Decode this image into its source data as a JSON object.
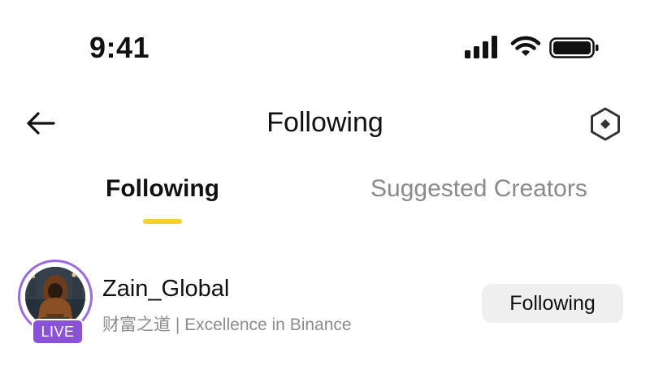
{
  "status_bar": {
    "time": "9:41",
    "icons": [
      "signal-icon",
      "wifi-icon",
      "battery-icon"
    ]
  },
  "header": {
    "title": "Following",
    "back_icon": "back-arrow-icon",
    "settings_icon": "hexagon-settings-icon"
  },
  "tabs": [
    {
      "label": "Following",
      "active": true
    },
    {
      "label": "Suggested Creators",
      "active": false
    }
  ],
  "accent_color": "#f5cf2c",
  "live_color": "#8a52d9",
  "following_list": [
    {
      "username": "Zain_Global",
      "bio": "财富之道 | Excellence in Binance",
      "badge": "LIVE",
      "button_label": "Following"
    }
  ]
}
